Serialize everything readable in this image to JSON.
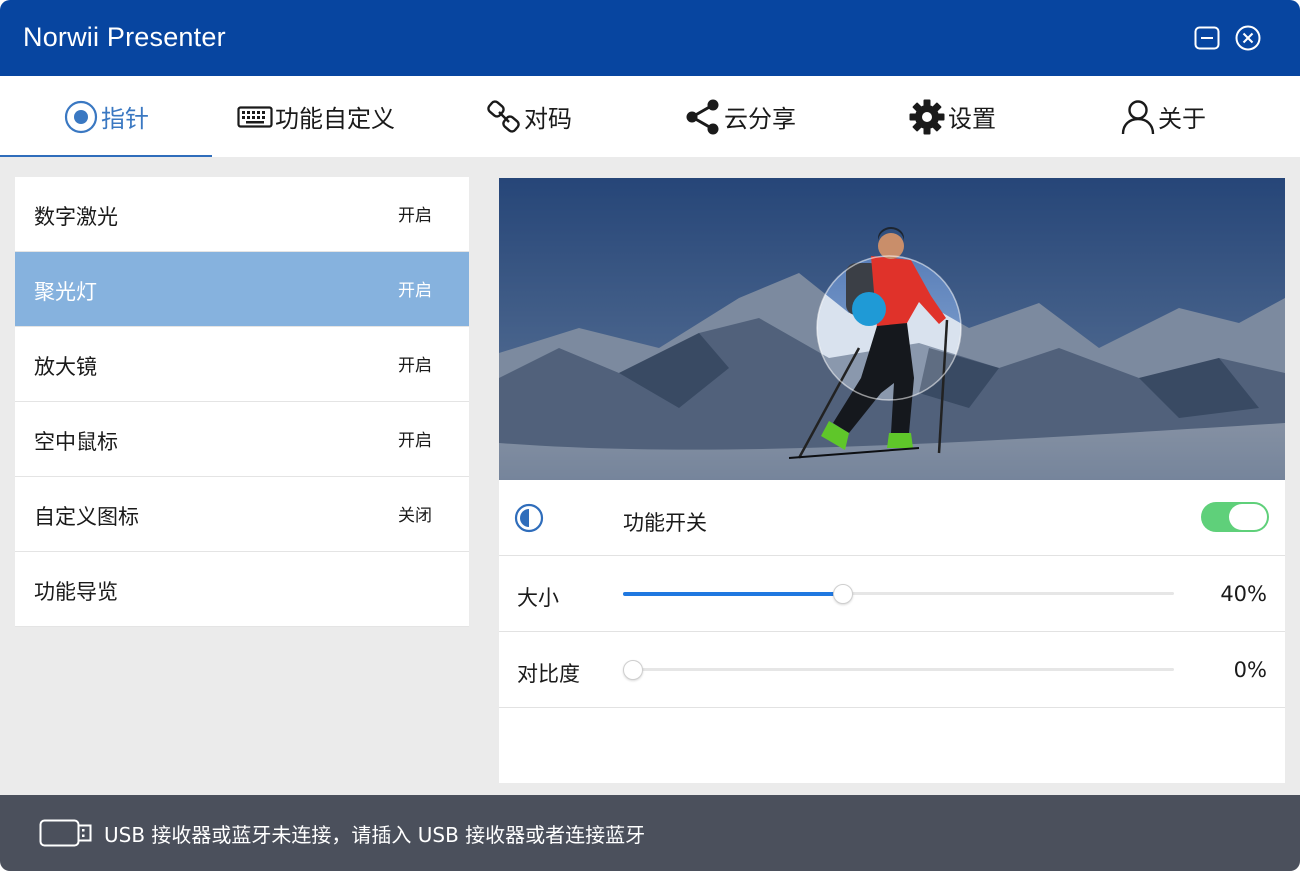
{
  "app": {
    "title": "Norwii Presenter"
  },
  "window_controls": {
    "minimize_icon": "minimize-icon",
    "close_icon": "close-circle-icon"
  },
  "tabs": [
    {
      "label": "指针",
      "icon": "target-pointer-icon",
      "active": true
    },
    {
      "label": "功能自定义",
      "icon": "keyboard-icon",
      "active": false
    },
    {
      "label": "对码",
      "icon": "link-icon",
      "active": false
    },
    {
      "label": "云分享",
      "icon": "share-icon",
      "active": false
    },
    {
      "label": "设置",
      "icon": "gear-icon",
      "active": false
    },
    {
      "label": "关于",
      "icon": "user-icon",
      "active": false
    }
  ],
  "features": [
    {
      "name": "数字激光",
      "state": "开启",
      "selected": false
    },
    {
      "name": "聚光灯",
      "state": "开启",
      "selected": true
    },
    {
      "name": "放大镜",
      "state": "开启",
      "selected": false
    },
    {
      "name": "空中鼠标",
      "state": "开启",
      "selected": false
    },
    {
      "name": "自定义图标",
      "state": "关闭",
      "selected": false
    },
    {
      "name": "功能导览",
      "state": "",
      "selected": false
    }
  ],
  "settings": {
    "feature_switch": {
      "label": "功能开关",
      "on": true,
      "icon": "contrast-icon"
    },
    "size": {
      "label": "大小",
      "value": 40,
      "display": "40%"
    },
    "contrast": {
      "label": "对比度",
      "value": 0,
      "display": "0%"
    }
  },
  "status": {
    "icon": "usb-receiver-icon",
    "text": "USB 接收器或蓝牙未连接，请插入 USB 接收器或者连接蓝牙"
  },
  "colors": {
    "title_bar": "#0745a0",
    "active_tab": "#3a78c2",
    "selected_item": "#86b2de",
    "toggle_on": "#5fd07a",
    "slider_fill": "#1f78e0",
    "status_bar": "#4b505c"
  }
}
